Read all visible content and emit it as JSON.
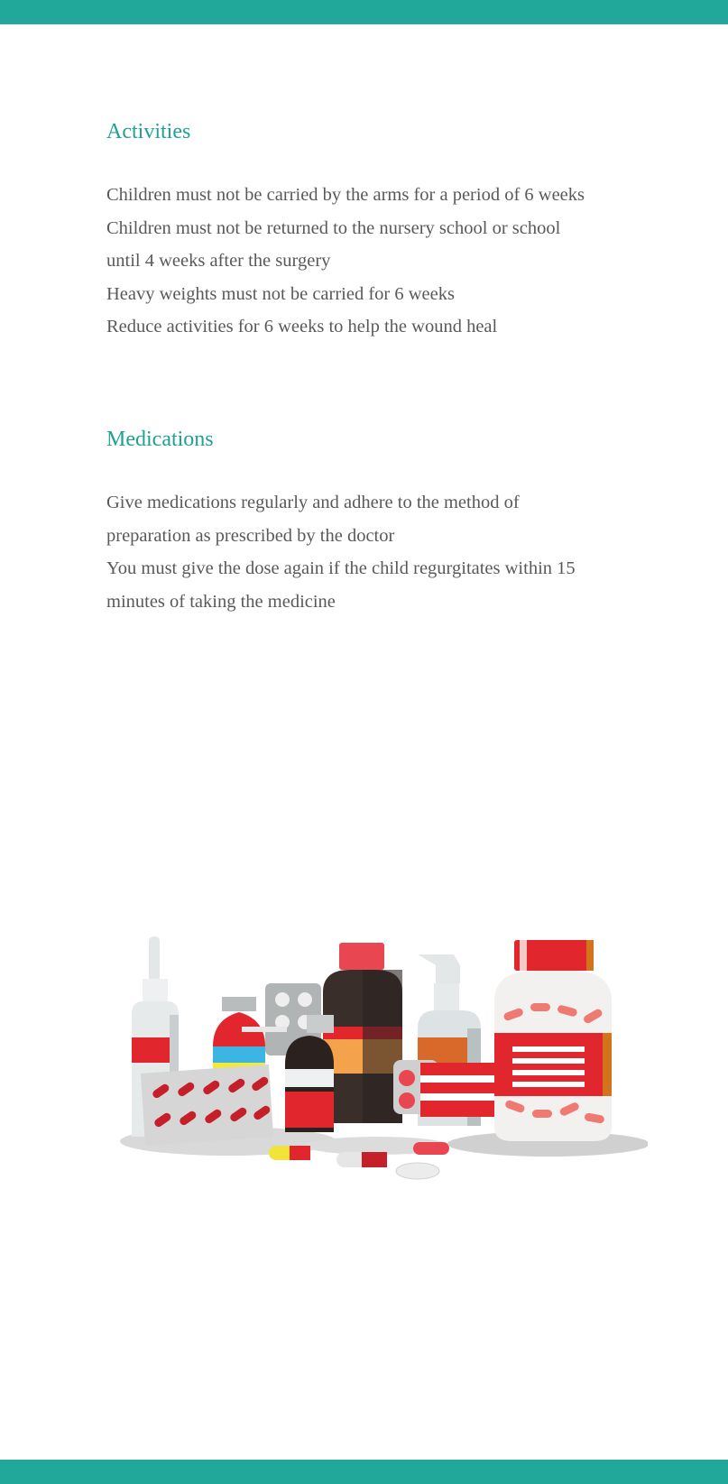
{
  "colors": {
    "accent": "#22a79b",
    "heading": "#1fa193",
    "body_text": "#58595b"
  },
  "activities": {
    "heading": "Activities",
    "lines": [
      "Children must not be carried by the arms for a period of 6 weeks",
      "Children must not be returned to the nursery school or school",
      "until 4 weeks after the surgery",
      "Heavy weights must not be carried for 6 weeks",
      "Reduce activities for 6 weeks to help the wound heal"
    ]
  },
  "medications": {
    "heading": "Medications",
    "lines": [
      "Give medications regularly and adhere to the method of",
      "preparation as prescribed by the doctor",
      "You must give the dose again if the child regurgitates within 15",
      "minutes of taking the medicine"
    ]
  },
  "illustration": {
    "icon": "medicine-bottles-and-pills-illustration"
  }
}
